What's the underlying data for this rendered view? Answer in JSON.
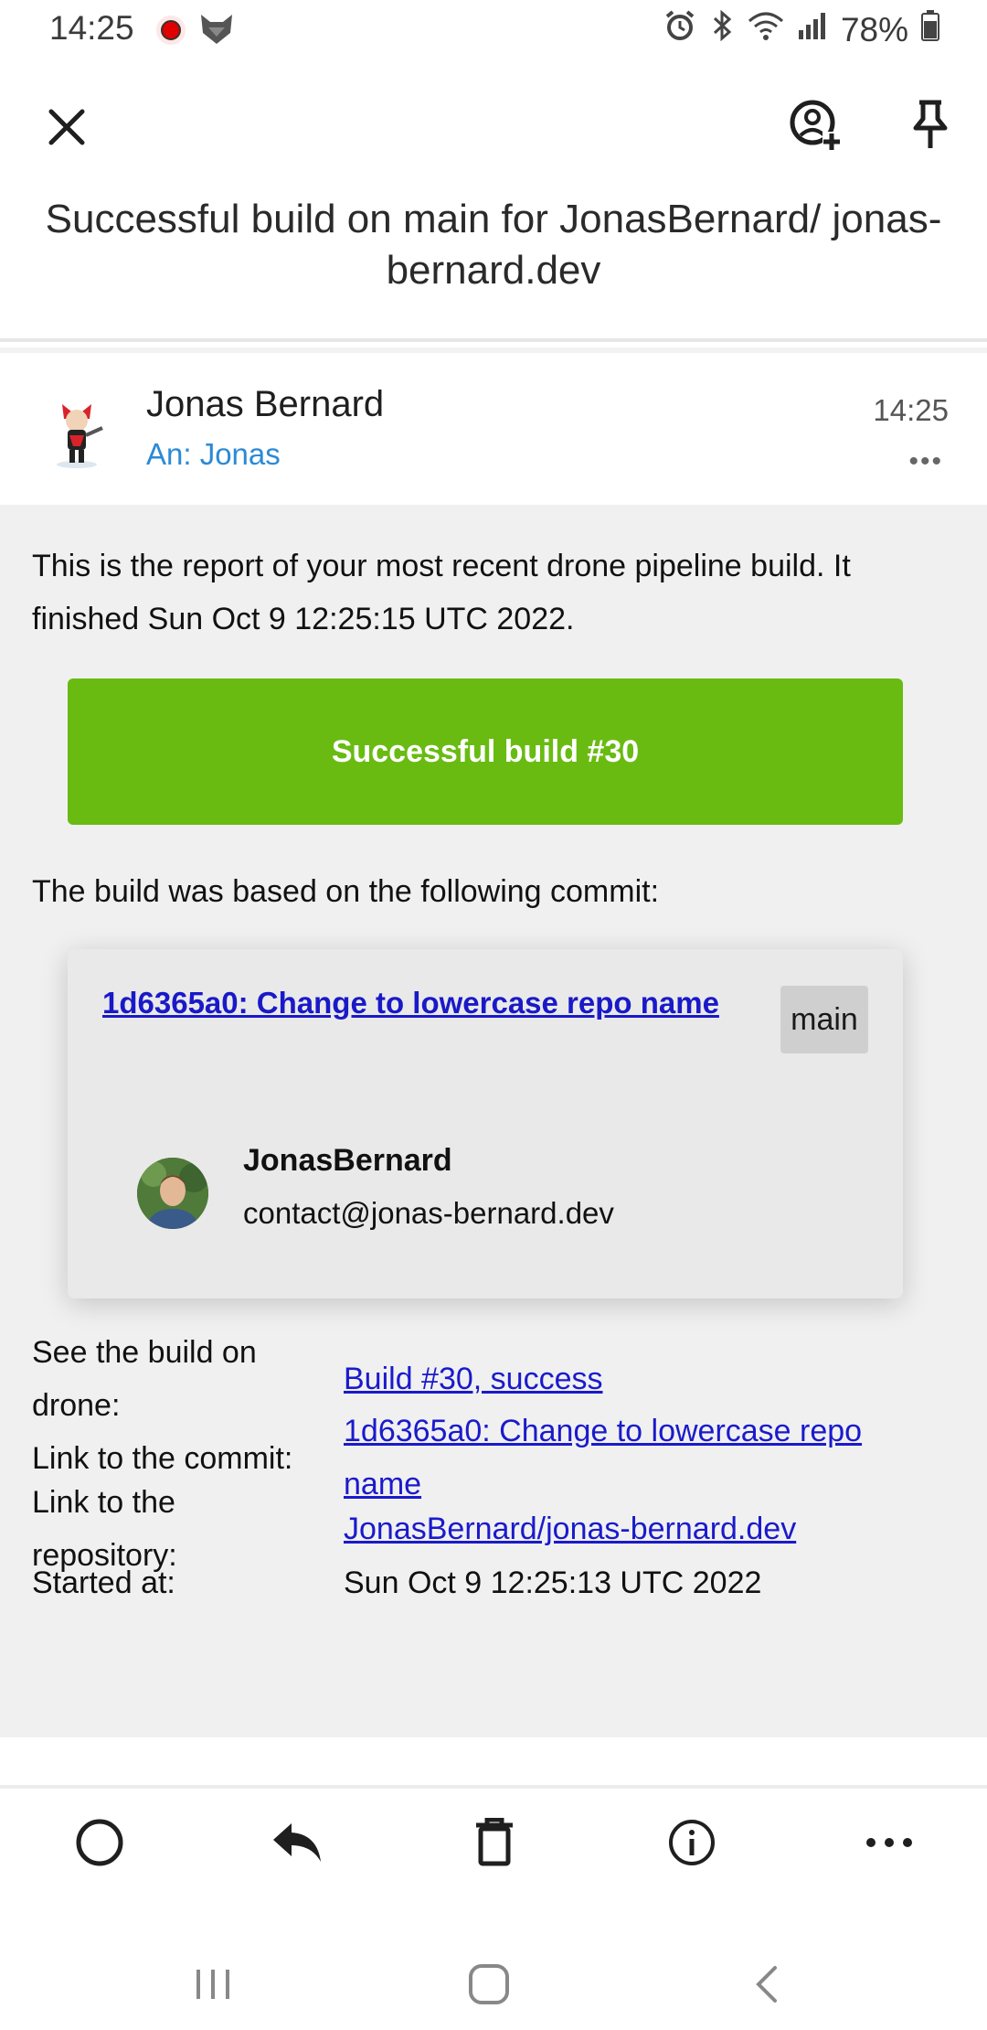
{
  "status_bar": {
    "time": "14:25",
    "battery": "78%"
  },
  "header": {
    "subject": "Successful build on main for JonasBernard/ jonas-bernard.dev"
  },
  "message": {
    "sender": "Jonas Bernard",
    "recipient": "An: Jonas",
    "time": "14:25",
    "more": "•••"
  },
  "email": {
    "intro": "This is the report of your most recent drone pipeline build. It finished Sun Oct 9 12:25:15 UTC 2022.",
    "banner": "Successful build #30",
    "commit_intro": "The build was based on the following commit:",
    "commit": {
      "link": "1d6365a0: Change to lowercase repo name",
      "branch": "main",
      "author_name": "JonasBernard",
      "author_email": "contact@jonas-bernard.dev"
    },
    "info": [
      {
        "label": "See the build on drone:",
        "value": "Build #30, success"
      },
      {
        "label": "Link to the commit:",
        "value": "1d6365a0: Change to lowercase repo name"
      },
      {
        "label": "Link to the repository:",
        "value": "JonasBernard/jonas-bernard.dev"
      },
      {
        "label": "Started at:",
        "value": "Sun Oct 9 12:25:13 UTC 2022"
      }
    ]
  },
  "icons": {
    "close": "close-icon",
    "add_contact": "person-add-icon",
    "pin": "pin-icon",
    "unread": "circle-icon",
    "reply": "reply-icon",
    "delete": "trash-icon",
    "info": "info-icon",
    "more": "more-horizontal-icon"
  },
  "colors": {
    "success": "#69bb12",
    "link": "#1a1acc",
    "recipient": "#2b8ad6"
  }
}
